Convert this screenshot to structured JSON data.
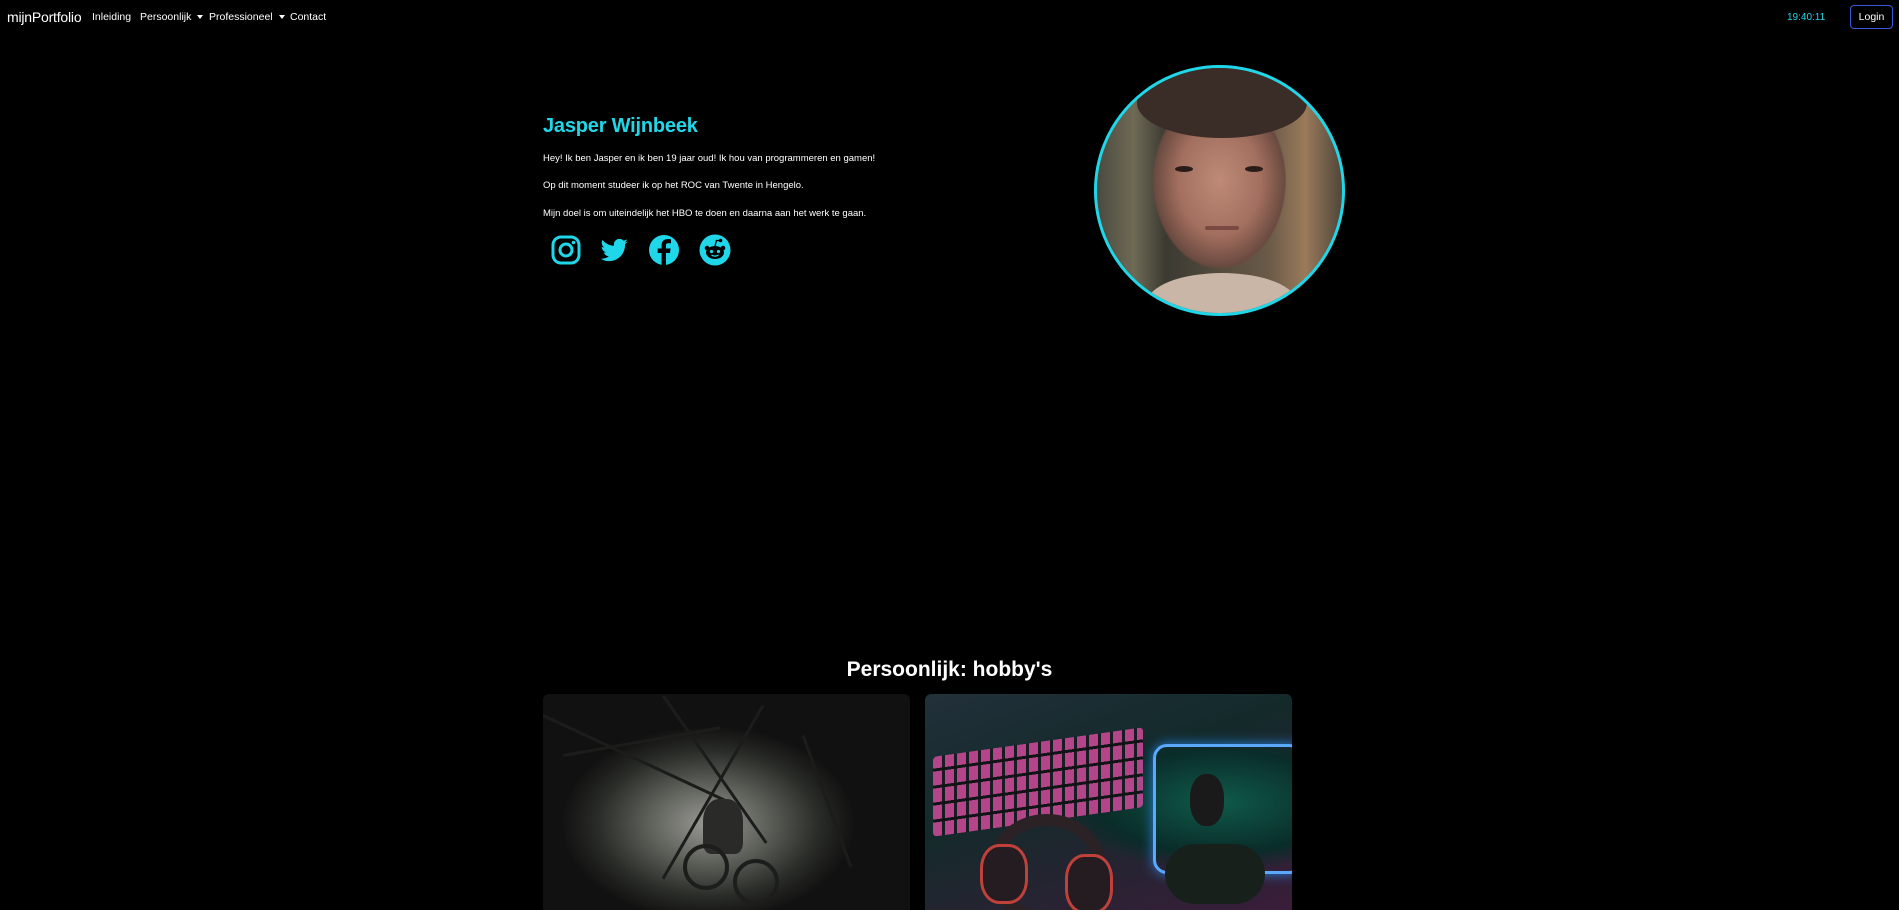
{
  "nav": {
    "brand": "mijnPortfolio",
    "links": [
      {
        "label": "Inleiding",
        "dropdown": false
      },
      {
        "label": "Persoonlijk",
        "dropdown": true
      },
      {
        "label": "Professioneel",
        "dropdown": true
      },
      {
        "label": "Contact",
        "dropdown": false
      }
    ],
    "clock": "19:40:11",
    "login_label": "Login"
  },
  "intro": {
    "name": "Jasper Wijnbeek",
    "paragraphs": [
      "Hey! Ik ben Jasper en ik ben 19 jaar oud! Ik hou van programmeren en gamen!",
      "Op dit moment studeer ik op het ROC van Twente in Hengelo.",
      "Mijn doel is om uiteindelijk het HBO te doen en daarna aan het werk te gaan."
    ],
    "socials": [
      "instagram-icon",
      "twitter-icon",
      "facebook-icon",
      "reddit-icon"
    ]
  },
  "hobbies": {
    "title": "Persoonlijk: hobby's",
    "cards": [
      "mountain-biking",
      "gaming"
    ]
  },
  "colors": {
    "accent": "#1fd7e8",
    "background": "#000000",
    "login_border": "#3d55d8"
  }
}
